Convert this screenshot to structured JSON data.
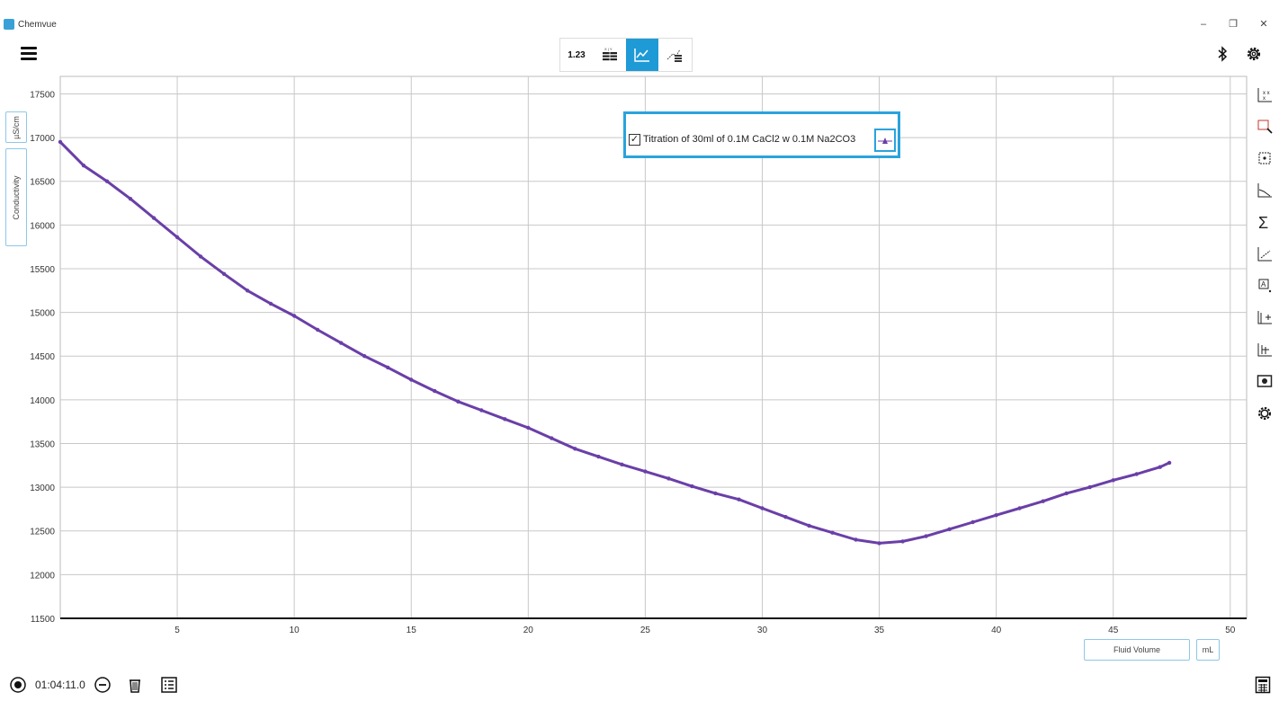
{
  "window": {
    "title": "Chemvue",
    "minimize": "–",
    "restore": "❐",
    "close": "✕"
  },
  "toolbar": {
    "views": [
      {
        "name": "digits-view",
        "label": "1.23",
        "active": false
      },
      {
        "name": "table-view",
        "icon": "table-icon",
        "active": false
      },
      {
        "name": "graph-view",
        "icon": "graph-icon",
        "active": true
      },
      {
        "name": "graph-table-view",
        "icon": "graph-table-icon",
        "active": false
      }
    ],
    "bluetooth": "bluetooth-icon",
    "settings": "gear-icon"
  },
  "y_axis": {
    "unit": "µS/cm",
    "quantity": "Conductivity"
  },
  "x_axis": {
    "quantity": "Fluid Volume",
    "unit": "mL"
  },
  "legend": {
    "label": "Titration of 30ml of 0.1M CaCl2 w 0.1M Na2CO3",
    "checked": true
  },
  "right_tools": [
    "autoscale-icon",
    "select-region-icon",
    "zoom-point-icon",
    "curve-fit-icon",
    "integral-icon",
    "tangent-icon",
    "annotation-icon",
    "add-axis-icon",
    "add-series-icon",
    "screenshot-icon",
    "graph-settings-icon"
  ],
  "bottom_bar": {
    "timer": "01:04:11.0",
    "record": "record-icon",
    "interval": "interval-icon",
    "delete": "trash-icon",
    "list": "list-icon",
    "calculator": "calculator-icon"
  },
  "chart_data": {
    "type": "scatter",
    "series": [
      {
        "name": "Titration of 30ml of 0.1M CaCl2 w 0.1M Na2CO3",
        "color": "#6a3fa8",
        "x": [
          0,
          1,
          2,
          3,
          4,
          5,
          6,
          7,
          8,
          9,
          10,
          11,
          12,
          13,
          14,
          15,
          16,
          17,
          18,
          19,
          20,
          21,
          22,
          23,
          24,
          25,
          26,
          27,
          28,
          29,
          30,
          31,
          32,
          33,
          34,
          35,
          36,
          37,
          38,
          39,
          40,
          41,
          42,
          43,
          44,
          45,
          46,
          47,
          47.4
        ],
        "y": [
          16950,
          16680,
          16500,
          16300,
          16080,
          15860,
          15640,
          15440,
          15250,
          15100,
          14960,
          14800,
          14650,
          14500,
          14370,
          14230,
          14100,
          13980,
          13880,
          13780,
          13680,
          13560,
          13440,
          13350,
          13260,
          13180,
          13100,
          13010,
          12930,
          12860,
          12760,
          12660,
          12560,
          12480,
          12400,
          12360,
          12380,
          12440,
          12520,
          12600,
          12680,
          12760,
          12840,
          12930,
          13000,
          13080,
          13150,
          13230,
          13280
        ]
      }
    ],
    "xlim": [
      0,
      50.7
    ],
    "ylim": [
      11500,
      17700
    ],
    "xticks": [
      5,
      10,
      15,
      20,
      25,
      30,
      35,
      40,
      45,
      50
    ],
    "yticks": [
      11500,
      12000,
      12500,
      13000,
      13500,
      14000,
      14500,
      15000,
      15500,
      16000,
      16500,
      17000,
      17500
    ],
    "xlabel": "Fluid Volume",
    "ylabel": "Conductivity",
    "grid": true,
    "legend_position": "top-center"
  }
}
